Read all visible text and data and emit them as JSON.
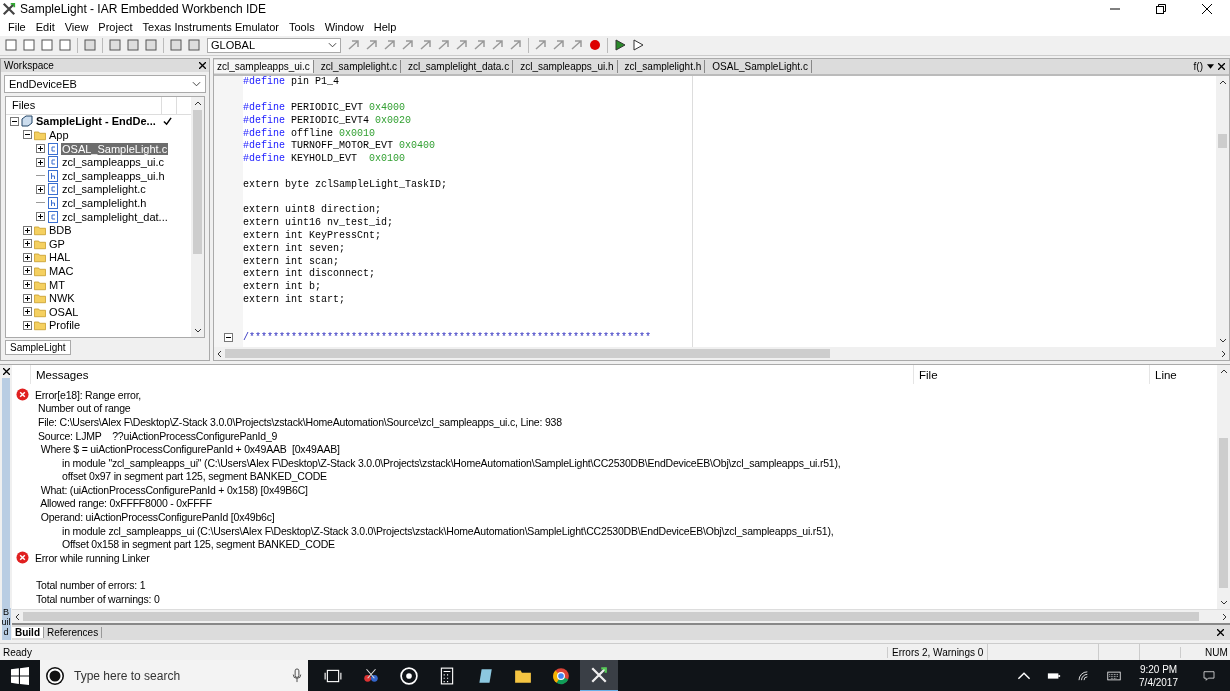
{
  "window": {
    "title": "SampleLight - IAR Embedded Workbench IDE"
  },
  "menu": [
    "File",
    "Edit",
    "View",
    "Project",
    "Texas Instruments Emulator",
    "Tools",
    "Window",
    "Help"
  ],
  "toolbar": {
    "scope": "GLOBAL"
  },
  "workspace": {
    "title": "Workspace",
    "configuration": "EndDeviceEB",
    "files_header": "Files",
    "tree": [
      {
        "label": "SampleLight - EndDe...",
        "kind": "project",
        "expanded": true,
        "selected": false,
        "children": [
          {
            "label": "App",
            "kind": "folder",
            "expanded": true,
            "selected": false,
            "children": [
              {
                "label": "OSAL_SampleLight.c",
                "kind": "c",
                "expanded": false,
                "selected": true
              },
              {
                "label": "zcl_sampleapps_ui.c",
                "kind": "c",
                "expanded": false,
                "selected": false
              },
              {
                "label": "zcl_sampleapps_ui.h",
                "kind": "h",
                "selected": false
              },
              {
                "label": "zcl_samplelight.c",
                "kind": "c",
                "expanded": false,
                "selected": false
              },
              {
                "label": "zcl_samplelight.h",
                "kind": "h",
                "selected": false
              },
              {
                "label": "zcl_samplelight_dat...",
                "kind": "c",
                "expanded": false,
                "selected": false
              }
            ]
          },
          {
            "label": "BDB",
            "kind": "folder",
            "expanded": false,
            "selected": false
          },
          {
            "label": "GP",
            "kind": "folder",
            "expanded": false,
            "selected": false
          },
          {
            "label": "HAL",
            "kind": "folder",
            "expanded": false,
            "selected": false
          },
          {
            "label": "MAC",
            "kind": "folder",
            "expanded": false,
            "selected": false
          },
          {
            "label": "MT",
            "kind": "folder",
            "expanded": false,
            "selected": false
          },
          {
            "label": "NWK",
            "kind": "folder",
            "expanded": false,
            "selected": false
          },
          {
            "label": "OSAL",
            "kind": "folder",
            "expanded": false,
            "selected": false
          },
          {
            "label": "Profile",
            "kind": "folder",
            "expanded": false,
            "selected": false
          }
        ]
      }
    ],
    "bottom_tab": "SampleLight"
  },
  "editor": {
    "tabs": [
      {
        "label": "zcl_sampleapps_ui.c",
        "selected": true
      },
      {
        "label": "zcl_samplelight.c",
        "selected": false
      },
      {
        "label": "zcl_samplelight_data.c",
        "selected": false
      },
      {
        "label": "zcl_sampleapps_ui.h",
        "selected": false
      },
      {
        "label": "zcl_samplelight.h",
        "selected": false
      },
      {
        "label": "OSAL_SampleLight.c",
        "selected": false
      }
    ],
    "function_button": "f()",
    "lines": [
      {
        "kind": "define",
        "keyword": "#define",
        "name": "pin P1_4"
      },
      {
        "kind": "blank"
      },
      {
        "kind": "define",
        "keyword": "#define",
        "name": "PERIODIC_EVT",
        "value": "0x4000"
      },
      {
        "kind": "define",
        "keyword": "#define",
        "name": "PERIODIC_EVT4",
        "value": "0x0020"
      },
      {
        "kind": "define",
        "keyword": "#define",
        "name": "offline",
        "value": "0x0010"
      },
      {
        "kind": "define",
        "keyword": "#define",
        "name": "TURNOFF_MOTOR_EVT",
        "value": "0x0400"
      },
      {
        "kind": "define",
        "keyword": "#define",
        "name": "KEYHOLD_EVT ",
        "value": "0x0100"
      },
      {
        "kind": "blank"
      },
      {
        "kind": "decl",
        "text": "extern byte zclSampleLight_TaskID;"
      },
      {
        "kind": "blank"
      },
      {
        "kind": "decl",
        "text": "extern uint8 direction;"
      },
      {
        "kind": "decl",
        "text": "extern uint16 nv_test_id;"
      },
      {
        "kind": "decl",
        "text": "extern int KeyPressCnt;"
      },
      {
        "kind": "decl",
        "text": "extern int seven;"
      },
      {
        "kind": "decl",
        "text": "extern int scan;"
      },
      {
        "kind": "decl",
        "text": "extern int disconnect;"
      },
      {
        "kind": "decl",
        "text": "extern int b;"
      },
      {
        "kind": "decl",
        "text": "extern int start;"
      },
      {
        "kind": "blank"
      },
      {
        "kind": "blank"
      },
      {
        "kind": "comment",
        "text": "/*******************************************************************"
      }
    ]
  },
  "messages": {
    "columns": [
      "Messages",
      "File",
      "Line"
    ],
    "lines": [
      {
        "kind": "error",
        "text": "Error[e18]: Range error,"
      },
      {
        "kind": "detail",
        "text": "Number out of range"
      },
      {
        "kind": "detail",
        "text": "File: C:\\Users\\Alex F\\Desktop\\Z-Stack 3.0.0\\Projects\\zstack\\HomeAutomation\\Source\\zcl_sampleapps_ui.c, Line: 938"
      },
      {
        "kind": "detail",
        "text": "Source: LJMP    ??uiActionProcessConfigurePanId_9"
      },
      {
        "kind": "detail",
        "text": " Where $ = uiActionProcessConfigurePanId + 0x49AAB  [0x49AAB]"
      },
      {
        "kind": "sub",
        "text": "in module \"zcl_sampleapps_ui\" (C:\\Users\\Alex F\\Desktop\\Z-Stack 3.0.0\\Projects\\zstack\\HomeAutomation\\SampleLight\\CC2530DB\\EndDeviceEB\\Obj\\zcl_sampleapps_ui.r51),"
      },
      {
        "kind": "sub",
        "text": "offset 0x97 in segment part 125, segment BANKED_CODE"
      },
      {
        "kind": "detail",
        "text": " What: (uiActionProcessConfigurePanId + 0x158) [0x49B6C]"
      },
      {
        "kind": "detail",
        "text": " Allowed range: 0xFFFF8000 - 0xFFFF"
      },
      {
        "kind": "detail",
        "text": " Operand: uiActionProcessConfigurePanId [0x49b6c]"
      },
      {
        "kind": "sub",
        "text": "in module zcl_sampleapps_ui (C:\\Users\\Alex F\\Desktop\\Z-Stack 3.0.0\\Projects\\zstack\\HomeAutomation\\SampleLight\\CC2530DB\\EndDeviceEB\\Obj\\zcl_sampleapps_ui.r51),"
      },
      {
        "kind": "sub",
        "text": "Offset 0x158 in segment part 125, segment BANKED_CODE"
      },
      {
        "kind": "error",
        "text": "Error while running Linker"
      },
      {
        "kind": "blank"
      },
      {
        "kind": "plain",
        "text": "Total number of errors: 1"
      },
      {
        "kind": "plain",
        "text": "Total number of warnings: 0"
      }
    ],
    "side_label": "Build",
    "tabs": [
      {
        "label": "Build",
        "selected": true
      },
      {
        "label": "References",
        "selected": false
      }
    ]
  },
  "status_bar": {
    "message": "Ready",
    "counts": "Errors 2, Warnings 0",
    "num": "NUM"
  },
  "taskbar": {
    "search_placeholder": "Type here to search",
    "time": "9:20 PM",
    "date": "7/4/2017"
  }
}
